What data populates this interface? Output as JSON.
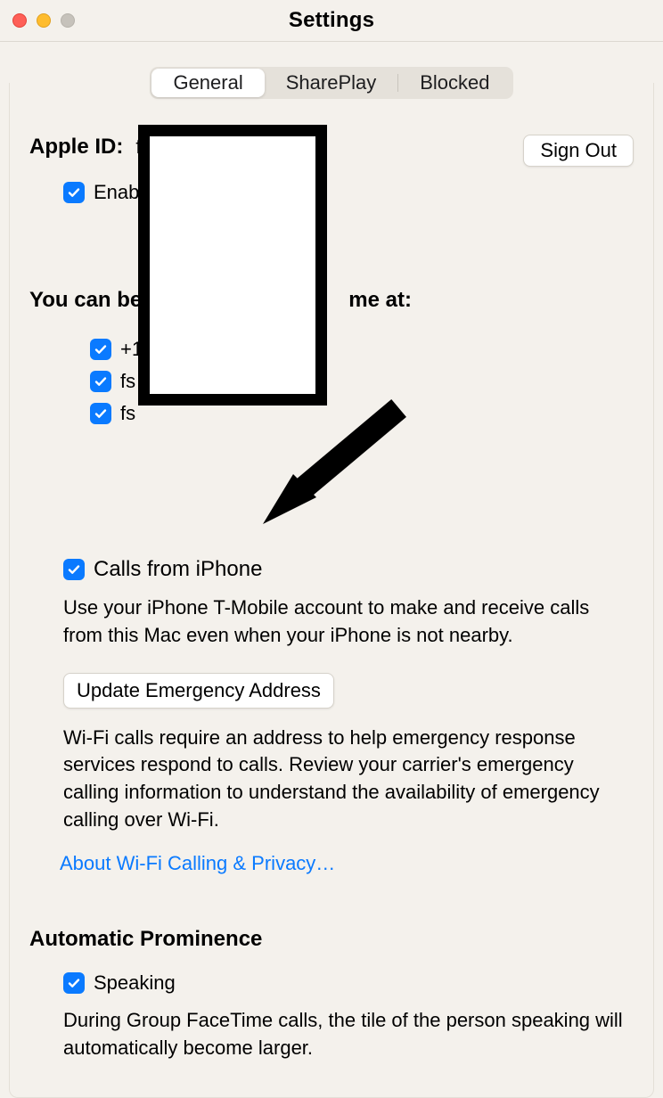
{
  "window": {
    "title": "Settings"
  },
  "tabs": {
    "general": "General",
    "shareplay": "SharePlay",
    "blocked": "Blocked",
    "active": "general"
  },
  "appleId": {
    "label": "Apple ID:",
    "value_prefix": "f",
    "signOut": "Sign Out",
    "enable_prefix": "Enab"
  },
  "reach": {
    "heading_prefix": "You can be",
    "heading_suffix": "me at:",
    "items": [
      {
        "label_prefix": "+1",
        "checked": true
      },
      {
        "label_prefix": "fs",
        "checked": true
      },
      {
        "label_prefix": "fs",
        "checked": true
      }
    ]
  },
  "calls": {
    "label": "Calls from iPhone",
    "checked": true,
    "desc": "Use your iPhone T-Mobile account to make and receive calls from this Mac even when your iPhone is not nearby.",
    "updateBtn": "Update Emergency Address",
    "wifiDesc": "Wi-Fi calls require an address to help emergency response services respond to calls.  Review your carrier's emergency calling information to understand the availability of emergency calling over Wi-Fi.",
    "link": "About Wi-Fi Calling & Privacy…"
  },
  "autoProminence": {
    "heading": "Automatic Prominence",
    "speakingLabel": "Speaking",
    "speakingChecked": true,
    "speakingDesc": "During Group FaceTime calls, the tile of the person speaking will automatically become larger."
  }
}
